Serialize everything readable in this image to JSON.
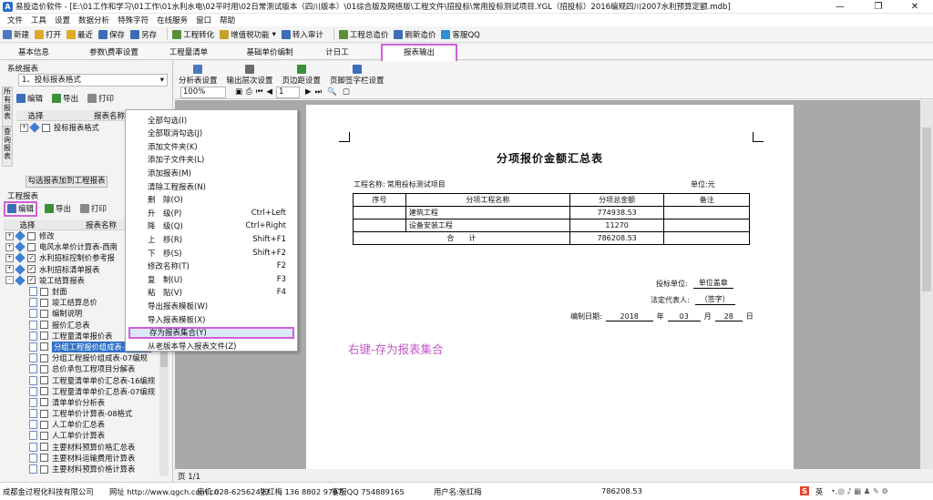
{
  "window": {
    "title": "易投造价软件 - [E:\\01工作和学习\\01工作\\01水利水电\\02平时用\\02日常测试版本（四川版本）\\01综合版及网络版\\工程文件\\招投标\\常用投标测试项目.YGL（招投标）2016编规四川2007水利预算定额.mdb]",
    "icon_letter": "A",
    "controls": [
      "—",
      "❐",
      "✕"
    ]
  },
  "menu": [
    "文件",
    "工具",
    "设置",
    "数据分析",
    "特殊字符",
    "在线服务",
    "窗口",
    "帮助"
  ],
  "toolbar": [
    {
      "label": "新建",
      "icon": "new-icon",
      "color": "#4a78c2"
    },
    {
      "label": "打开",
      "icon": "open-icon",
      "color": "#e0a92c"
    },
    {
      "label": "最近",
      "icon": "recent-icon",
      "color": "#e0a92c"
    },
    {
      "label": "保存",
      "icon": "save-icon",
      "color": "#3a6fb8"
    },
    {
      "label": "另存",
      "icon": "save-as-icon",
      "color": "#3a6fb8"
    },
    {
      "label": "工程转化",
      "icon": "convert-icon",
      "color": "#5a8f3a"
    },
    {
      "label": "增值税功能",
      "icon": "tax-icon",
      "color": "#c8a22a"
    },
    {
      "label": "转入审计",
      "icon": "audit-icon",
      "color": "#3a6fb8"
    },
    {
      "label": "工程总造价",
      "icon": "cost-icon",
      "color": "#5a8f3a"
    },
    {
      "label": "刷新造价",
      "icon": "refresh-icon",
      "color": "#3a6fb8"
    },
    {
      "label": "客服QQ",
      "icon": "qq-icon",
      "color": "#2c8fd8"
    }
  ],
  "tabs": [
    "基本信息",
    "参数\\费率设置",
    "工程量清单",
    "基础单价编制",
    "计日工",
    "报表输出"
  ],
  "left": {
    "system_title": "系统报表",
    "combo_value": "1、投标报表格式",
    "vtab_all": "所有报表",
    "vtab_query": "查询报表",
    "edit_label": "编辑",
    "export_label": "导出",
    "print_label": "打印",
    "col_select": "选择",
    "col_name": "报表名称",
    "sys_row": "投标报表格式",
    "add_button": "勾选报表加到工程报表",
    "project_title": "工程报表",
    "tree": [
      {
        "level": 0,
        "exp": "+",
        "checked": false,
        "label": "修改"
      },
      {
        "level": 0,
        "exp": "+",
        "checked": false,
        "label": "电风水单价计算表-西南"
      },
      {
        "level": 0,
        "exp": "+",
        "checked": true,
        "label": "水利招标控制价参考报"
      },
      {
        "level": 0,
        "exp": "+",
        "checked": true,
        "label": "水利招标清单报表"
      },
      {
        "level": 0,
        "exp": "-",
        "checked": true,
        "label": "竣工结算报表"
      },
      {
        "level": 1,
        "checked": false,
        "label": "封面"
      },
      {
        "level": 1,
        "checked": false,
        "label": "竣工结算总价"
      },
      {
        "level": 1,
        "checked": false,
        "label": "编制说明"
      },
      {
        "level": 1,
        "checked": false,
        "label": "报价汇总表"
      },
      {
        "level": 1,
        "checked": false,
        "label": "工程量清单报价表"
      },
      {
        "level": 1,
        "checked": false,
        "label": "分组工程报价组成表-16编规",
        "selected": true
      },
      {
        "level": 1,
        "checked": false,
        "label": "分组工程报价组成表-07编规"
      },
      {
        "level": 1,
        "checked": false,
        "label": "总价承包工程项目分解表"
      },
      {
        "level": 1,
        "checked": false,
        "label": "工程量清单单价汇总表-16编规"
      },
      {
        "level": 1,
        "checked": false,
        "label": "工程量清单单价汇总表-07编规"
      },
      {
        "level": 1,
        "checked": false,
        "label": "清单单价分析表"
      },
      {
        "level": 1,
        "checked": false,
        "label": "工程单价计算表-08格式"
      },
      {
        "level": 1,
        "checked": false,
        "label": "人工单价汇总表"
      },
      {
        "level": 1,
        "checked": false,
        "label": "人工单价计算表"
      },
      {
        "level": 1,
        "checked": false,
        "label": "主要材料预算价格汇总表"
      },
      {
        "level": 1,
        "checked": false,
        "label": "主要材料运输费用计算表"
      },
      {
        "level": 1,
        "checked": false,
        "label": "主要材料预算价格计算表"
      }
    ]
  },
  "context_menu": [
    {
      "label": "全部勾选(I)",
      "shortcut": ""
    },
    {
      "label": "全部取消勾选(J)",
      "shortcut": ""
    },
    {
      "label": "添加文件夹(K)",
      "shortcut": ""
    },
    {
      "label": "添加子文件夹(L)",
      "shortcut": ""
    },
    {
      "label": "添加报表(M)",
      "shortcut": ""
    },
    {
      "label": "清除工程报表(N)",
      "shortcut": ""
    },
    {
      "label": "删　除(O)",
      "shortcut": ""
    },
    {
      "label": "升　级(P)",
      "shortcut": "Ctrl+Left"
    },
    {
      "label": "降　级(Q)",
      "shortcut": "Ctrl+Right"
    },
    {
      "label": "上　移(R)",
      "shortcut": "Shift+F1"
    },
    {
      "label": "下　移(S)",
      "shortcut": "Shift+F2"
    },
    {
      "label": "修改名称(T)",
      "shortcut": "F2"
    },
    {
      "label": "复　制(U)",
      "shortcut": "F3"
    },
    {
      "label": "粘　贴(V)",
      "shortcut": "F4"
    },
    {
      "label": "导出报表模板(W)",
      "shortcut": ""
    },
    {
      "label": "导入报表模板(X)",
      "shortcut": ""
    },
    {
      "label": "存为报表集合(Y)",
      "shortcut": "",
      "highlight": true
    },
    {
      "label": "从老版本导入报表文件(Z)",
      "shortcut": ""
    }
  ],
  "right_toolbar": {
    "buttons": [
      "分析表设置",
      "输出层次设置",
      "页边距设置",
      "页脚签字栏设置"
    ],
    "zoom": "100%",
    "page_input": "1"
  },
  "report": {
    "title": "分项报价金额汇总表",
    "project_label": "工程名称:",
    "project_name": "常用投标测试项目",
    "unit_label": "单位:元",
    "headers": [
      "序号",
      "分项工程名称",
      "分项总金额",
      "备注"
    ],
    "rows": [
      [
        "",
        "建筑工程",
        "774938.53",
        ""
      ],
      [
        "",
        "设备安装工程",
        "11270",
        ""
      ],
      [
        "合　　计",
        "",
        "786208.53",
        ""
      ]
    ],
    "bidder_label": "投标单位:",
    "bidder_value": "单位盖章",
    "legal_label": "法定代表人:",
    "legal_value": "（签字）",
    "date_label": "编制日期:",
    "year": "2018",
    "year_unit": "年",
    "month": "03",
    "month_unit": "月",
    "day": "28",
    "day_unit": "日"
  },
  "annotation": "右键-存为报表集合",
  "page_indicator": "页 1/1",
  "status": {
    "company": "成都金过程化科技有限公司",
    "website": "网址 http://www.qgch.com.cn",
    "phone": "座机 028-62562477",
    "contact": "张红梅 136 8802 9797",
    "qq": "客服QQ 754889165",
    "user": "用户名:张红梅",
    "total": "786208.53",
    "ime": "英"
  },
  "colors": {
    "accent": "#d15fd8",
    "annotation": "#c157c9",
    "tree_icon": "#3d7fd4"
  }
}
